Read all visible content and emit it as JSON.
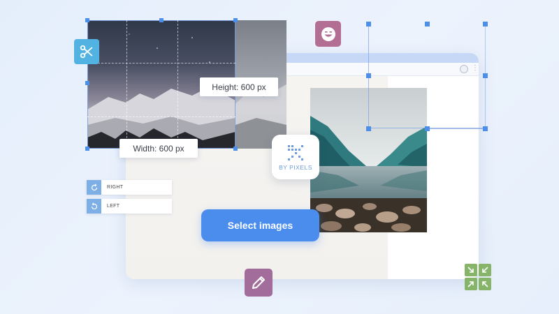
{
  "browser": {
    "menu_glyph": "⋮"
  },
  "labels": {
    "height": "Height: 600 px",
    "width": "Width: 600 px"
  },
  "rotate": [
    {
      "label": "RIGHT",
      "icon": "rotate-right-icon"
    },
    {
      "label": "LEFT",
      "icon": "rotate-left-icon"
    }
  ],
  "logo": {
    "text": "BY PIXELS",
    "color": "#6d9de0"
  },
  "actions": {
    "select_label": "Select images"
  },
  "icons": {
    "scissors": "scissors-icon",
    "emoji": "smiley-icon",
    "pencil": "pencil-icon",
    "resize": "resize-arrows-icon"
  },
  "colors": {
    "accent": "#4a8ded",
    "scissors_bg": "#52b3e3",
    "emoji_bg": "#b26e93",
    "pencil_bg": "#a26d9b",
    "resize_bg": "#86b56a"
  }
}
